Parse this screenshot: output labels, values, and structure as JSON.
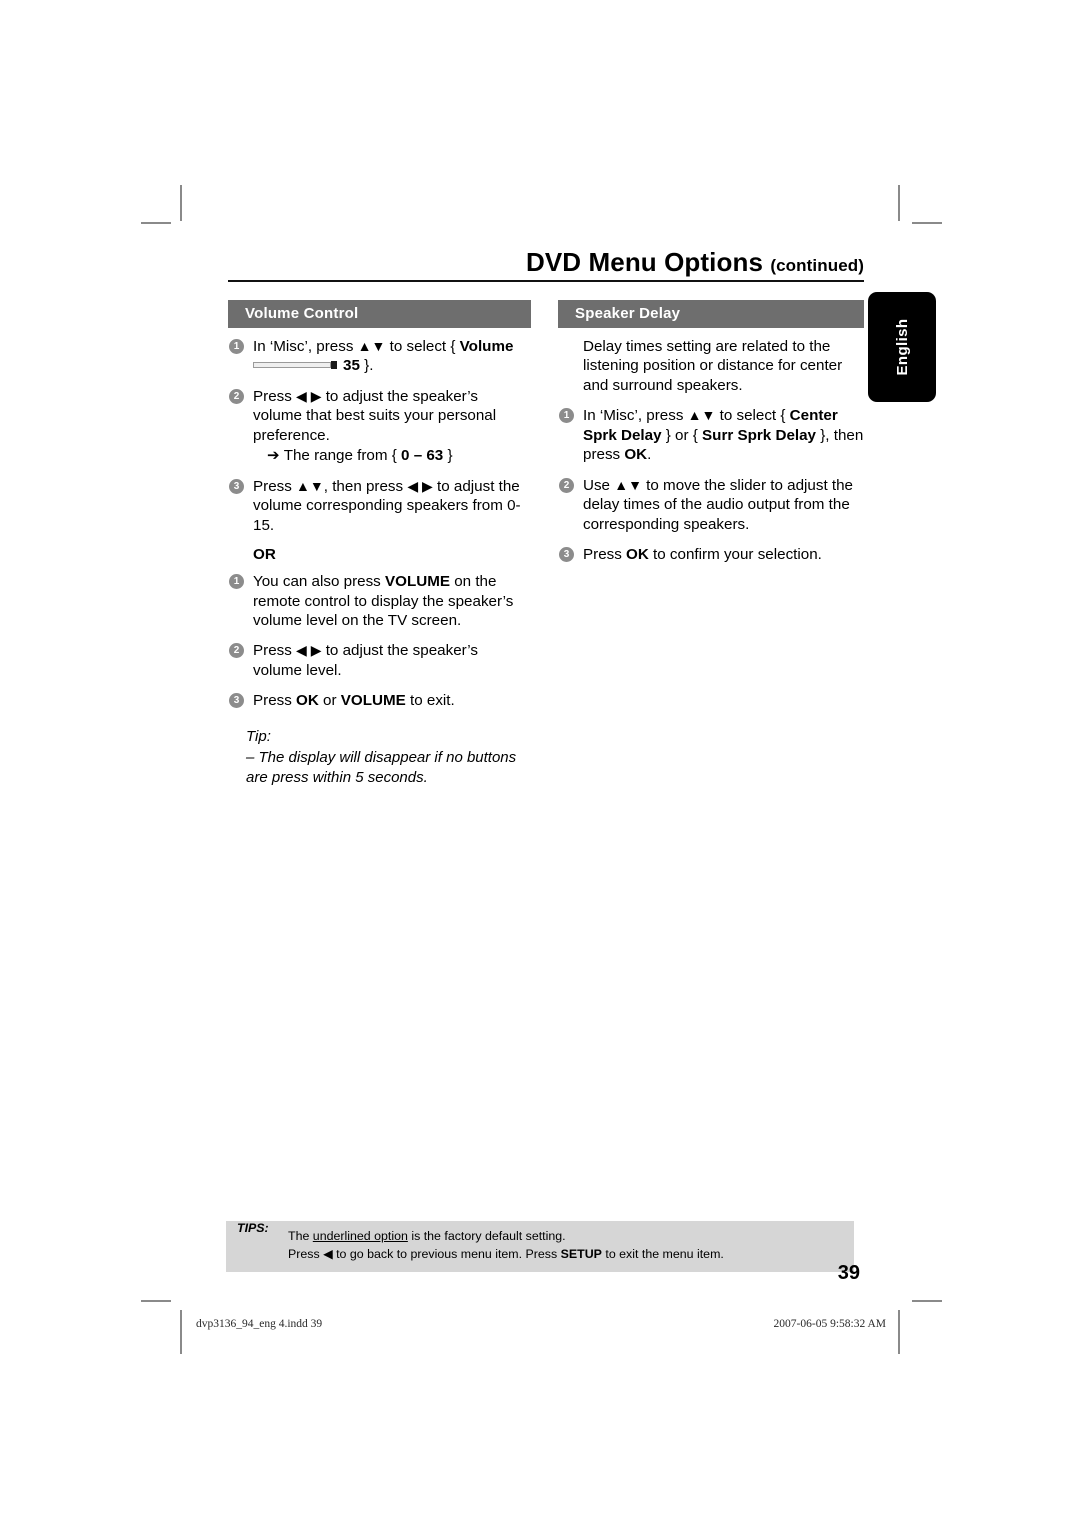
{
  "header": {
    "title": "DVD Menu Options",
    "continued": "(continued)"
  },
  "side_tab": {
    "label": "English"
  },
  "left_column": {
    "section_title": "Volume Control",
    "steps": [
      {
        "num": "1",
        "text_a": "In ‘Misc’, press ",
        "glyph": "▲▼",
        "text_b": " to select { ",
        "bold": "Volume",
        "text_c": "",
        "slider_value": "35",
        "text_d": " }."
      },
      {
        "num": "2",
        "text_a": "Press ",
        "glyph": "◀ ▶",
        "text_b": " to adjust the speaker’s volume that best suits your personal preference.",
        "sub_arrow": "➔",
        "sub_text_a": "The range from { ",
        "sub_bold": "0 – 63",
        "sub_text_b": " }"
      },
      {
        "num": "3",
        "text_a": "Press ",
        "glyph_a": "▲▼",
        "text_b": ", then press ",
        "glyph_b": "◀ ▶",
        "text_c": " to adjust the volume corresponding speakers from 0-15."
      }
    ],
    "or_label": "OR",
    "or_steps": [
      {
        "num": "1",
        "text_a": "You can also press ",
        "bold": "VOLUME",
        "text_b": " on the remote control to display the speaker’s volume level on the TV screen."
      },
      {
        "num": "2",
        "text_a": "Press ",
        "glyph": "◀ ▶",
        "text_b": " to adjust the speaker’s volume level."
      },
      {
        "num": "3",
        "text_a": "Press ",
        "bold_a": "OK",
        "text_b": " or ",
        "bold_b": "VOLUME",
        "text_c": " to exit."
      }
    ],
    "tip": {
      "label": "Tip:",
      "text": "–  The display will disappear if no buttons are press within 5 seconds."
    }
  },
  "right_column": {
    "section_title": "Speaker Delay",
    "intro": "Delay times setting are related to the listening position or distance for center and surround speakers.",
    "steps": [
      {
        "num": "1",
        "text_a": "In ‘Misc’, press ",
        "glyph": "▲▼",
        "text_b": " to select { ",
        "bold_a": "Center Sprk Delay",
        "text_c": " } or { ",
        "bold_b": "Surr Sprk Delay",
        "text_d": " }, then press ",
        "bold_c": "OK",
        "text_e": "."
      },
      {
        "num": "2",
        "text_a": "Use ",
        "glyph": "▲▼",
        "text_b": " to move the slider to adjust the delay times of the audio output from the corresponding speakers."
      },
      {
        "num": "3",
        "text_a": "Press ",
        "bold": "OK",
        "text_b": " to confirm your selection."
      }
    ]
  },
  "tips_box": {
    "label": "TIPS:",
    "line1_a": "The ",
    "line1_underlined": "underlined option",
    "line1_b": " is the factory default setting.",
    "line2_a": "Press ",
    "line2_glyph": "◀",
    "line2_b": " to go back to previous menu item. Press ",
    "line2_bold": "SETUP",
    "line2_c": " to exit the menu item."
  },
  "page_number": "39",
  "doc_footer": {
    "filename": "dvp3136_94_eng 4.indd   39",
    "timestamp": "2007-06-05   9:58:32 AM"
  },
  "colors": {
    "section_bar": "#6e6e6e",
    "bullet": "#8c8c8c",
    "tips_bg": "#d6d6d6",
    "tab_bg": "#000000",
    "rule": "#111111"
  }
}
